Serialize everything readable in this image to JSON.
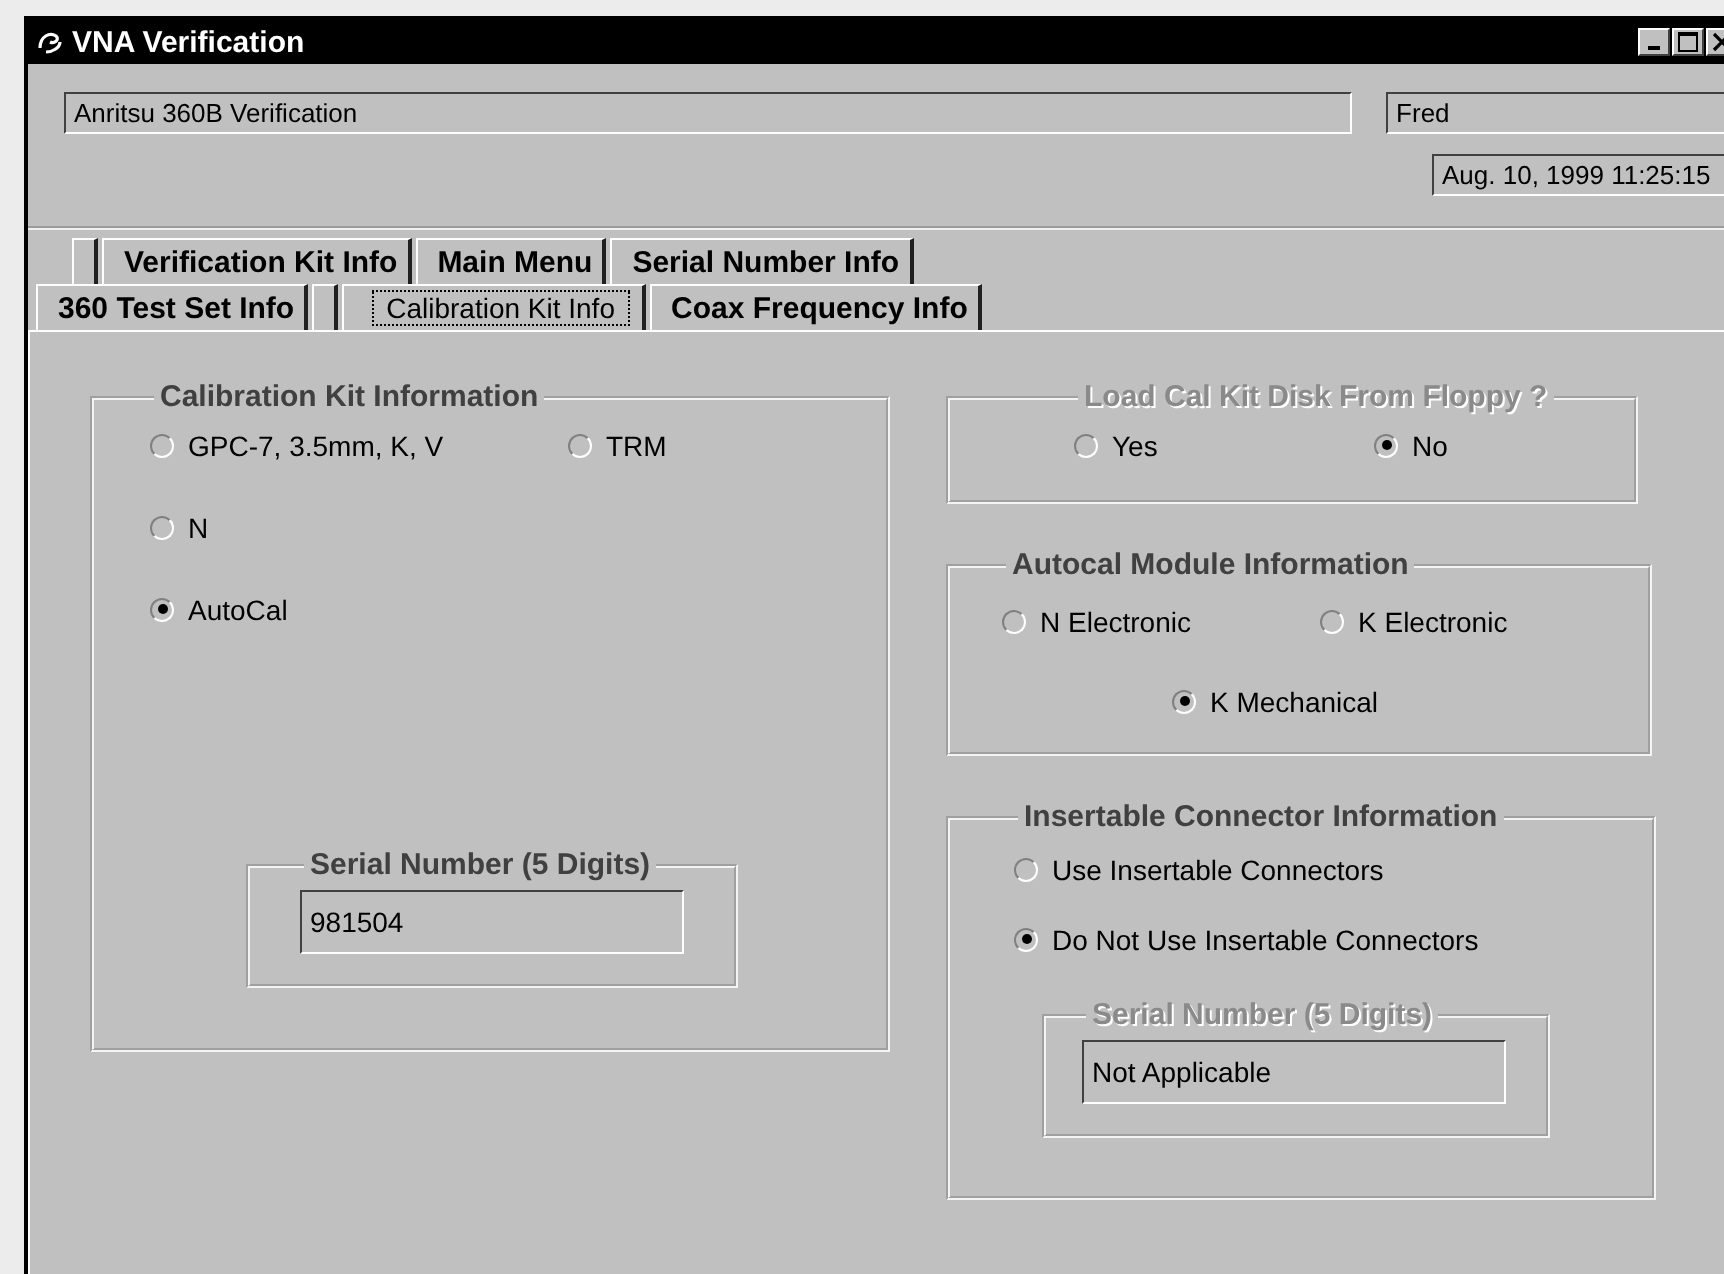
{
  "window": {
    "title": "VNA Verification"
  },
  "header": {
    "description": "Anritsu 360B Verification",
    "user": "Fred",
    "timestamp": "Aug. 10, 1999 11:25:15"
  },
  "tab_rows": [
    {
      "tabs": [
        {
          "kind": "blank",
          "selected": false
        },
        {
          "kind": "text",
          "label": "Verification Kit Info",
          "selected": false
        },
        {
          "kind": "text",
          "label": "Main Menu",
          "selected": false
        },
        {
          "kind": "text",
          "label": "Serial Number Info",
          "selected": false
        }
      ]
    },
    {
      "tabs": [
        {
          "kind": "text",
          "label": "360 Test Set Info",
          "selected": false
        },
        {
          "kind": "blank",
          "selected": false
        },
        {
          "kind": "text",
          "label": "Calibration Kit Info",
          "selected": true
        },
        {
          "kind": "text",
          "label": "Coax Frequency Info",
          "selected": false
        }
      ]
    }
  ],
  "calibration_kit": {
    "title": "Calibration Kit Information",
    "disabled": false,
    "options": [
      {
        "label": "GPC-7, 3.5mm, K, V",
        "selected": false
      },
      {
        "label": "TRM",
        "selected": false
      },
      {
        "label": "N",
        "selected": false
      },
      {
        "label": "AutoCal",
        "selected": true
      }
    ],
    "serial": {
      "title": "Serial Number (5 Digits)",
      "value": "981504",
      "disabled": false
    }
  },
  "load_from_floppy": {
    "title": "Load Cal Kit Disk From Floppy ?",
    "disabled": true,
    "options": [
      {
        "label": "Yes",
        "selected": false
      },
      {
        "label": "No",
        "selected": true
      }
    ]
  },
  "autocal_module": {
    "title": "Autocal Module Information",
    "disabled": false,
    "options": [
      {
        "label": "N Electronic",
        "selected": false
      },
      {
        "label": "K Electronic",
        "selected": false
      },
      {
        "label": "K Mechanical",
        "selected": true
      }
    ]
  },
  "insertable_connector": {
    "title": "Insertable Connector Information",
    "disabled": false,
    "options": [
      {
        "label": "Use Insertable Connectors",
        "selected": false
      },
      {
        "label": "Do Not Use Insertable Connectors",
        "selected": true
      }
    ],
    "serial": {
      "title": "Serial Number (5 Digits)",
      "value": "Not Applicable",
      "disabled": true
    }
  }
}
